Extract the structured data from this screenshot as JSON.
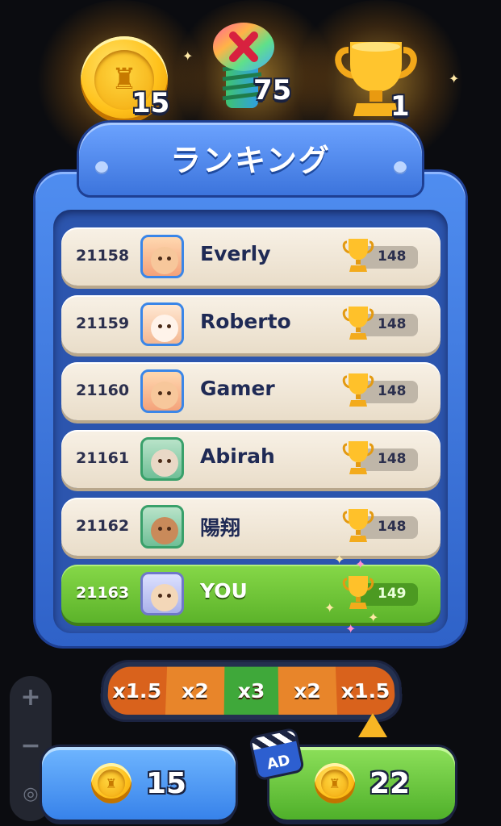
{
  "header": {
    "coins": "15",
    "bolts": "75",
    "trophies": "1"
  },
  "panel": {
    "title": "ランキング"
  },
  "ranking": [
    {
      "rank": "21158",
      "name": "Everly",
      "score": "148",
      "avatar": "fox-avatar"
    },
    {
      "rank": "21159",
      "name": "Roberto",
      "score": "148",
      "avatar": "bunny-avatar"
    },
    {
      "rank": "21160",
      "name": "Gamer",
      "score": "148",
      "avatar": "fox-avatar"
    },
    {
      "rank": "21161",
      "name": "Abirah",
      "score": "148",
      "avatar": "raccoon-avatar"
    },
    {
      "rank": "21162",
      "name": "陽翔",
      "score": "148",
      "avatar": "monkey-avatar"
    },
    {
      "rank": "21163",
      "name": "YOU",
      "score": "149",
      "avatar": "hamster-avatar",
      "is_you": true
    }
  ],
  "multiplier": {
    "segments": [
      "x1.5",
      "x2",
      "x3",
      "x2",
      "x1.5"
    ],
    "selected_index": 4
  },
  "zoom": {
    "plus": "+",
    "minus": "−"
  },
  "buttons": {
    "claim_value": "15",
    "ad_value": "22",
    "ad_badge": "AD"
  },
  "colors": {
    "panel_blue": "#3a6fd8",
    "you_green": "#6cc436",
    "coin_gold": "#ffc21c",
    "multiplier_orange": "#e07a24",
    "multiplier_green": "#3fa83a"
  }
}
